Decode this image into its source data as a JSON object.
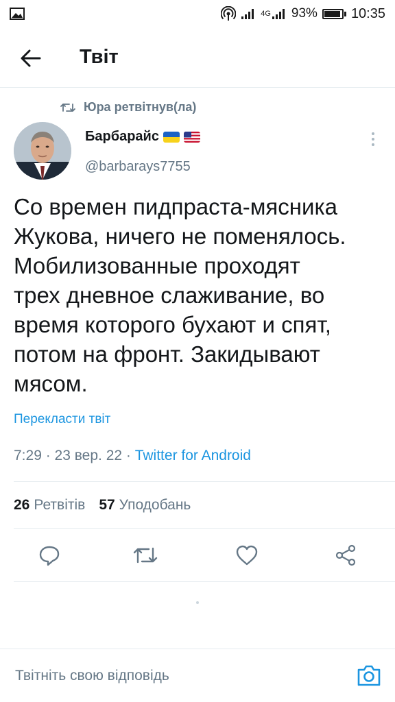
{
  "status_bar": {
    "signal_4g": "4G",
    "battery_percent": "93%",
    "battery_level": 0.93,
    "time": "10:35"
  },
  "header": {
    "title": "Твіт"
  },
  "tweet": {
    "retweeted_by": "Юра ретвітнув(ла)",
    "display_name": "Барбарайс",
    "flags": [
      "🇺🇦",
      "🇺🇸"
    ],
    "handle": "@barbarays7755",
    "text_lines": [
      "Со времен пидпраста-мясника",
      "Жукова, ничего не поменялось.",
      "Мобилизованные проходят",
      "трех дневное слаживание, во",
      "время которого бухают и спят,",
      "потом на фронт. Закидывают",
      "мясом."
    ],
    "translate_label": "Перекласти твіт",
    "time": "7:29",
    "date": "23 вер. 22",
    "source": "Twitter for Android",
    "retweets_count": "26",
    "retweets_label": "Ретвітів",
    "likes_count": "57",
    "likes_label": "Уподобань"
  },
  "actions": {
    "reply_icon": "reply-icon",
    "retweet_icon": "retweet-icon",
    "like_icon": "heart-icon",
    "share_icon": "share-icon"
  },
  "reply": {
    "placeholder": "Твітніть свою відповідь"
  },
  "colors": {
    "accent": "#1b95e0",
    "secondary_text": "#657786",
    "divider": "#e6ecf0"
  }
}
